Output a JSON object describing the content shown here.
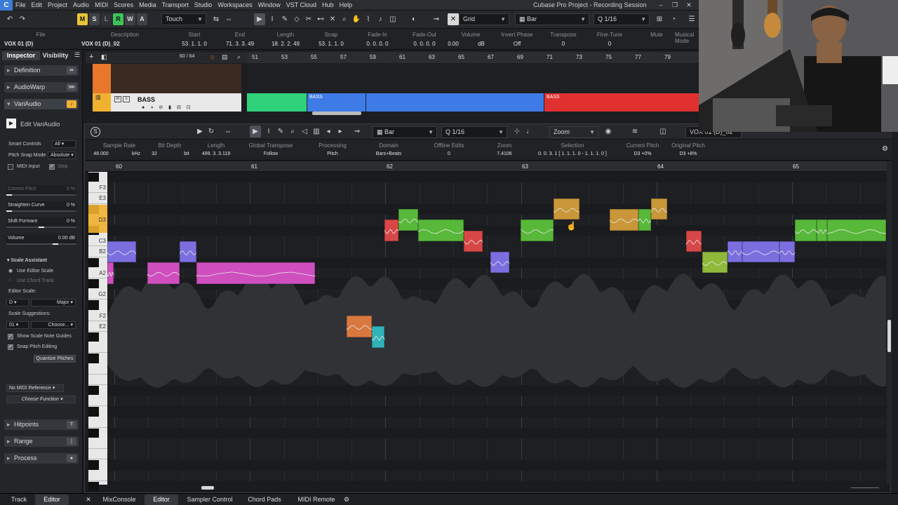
{
  "window": {
    "title": "Cubase Pro Project - Recording Session"
  },
  "menu": [
    "File",
    "Edit",
    "Project",
    "Audio",
    "MIDI",
    "Scores",
    "Media",
    "Transport",
    "Studio",
    "Workspaces",
    "Window",
    "VST Cloud",
    "Hub",
    "Help"
  ],
  "toolbar": {
    "modes": [
      "M",
      "S",
      "L",
      "R",
      "W",
      "A"
    ],
    "automation_mode": "Touch",
    "snap_type": "Grid",
    "grid_type": "Bar",
    "quantize": "1/16"
  },
  "infoline": {
    "headers": [
      "File",
      "Description",
      "Start",
      "End",
      "Length",
      "Snap",
      "Fade-In",
      "Fade-Out",
      "Volume",
      "Invert Phase",
      "Transpose",
      "Fine-Tune",
      "Mute",
      "Musical Mode"
    ],
    "values": [
      "VOX 01 (D)",
      "VOX 01 (D)_02",
      "53. 1. 1. 0",
      "71. 3. 3. 49",
      "18. 2. 2. 49",
      "53. 1. 1. 0",
      "0. 0. 0. 0",
      "0. 0. 0. 0",
      "0.00",
      "dB",
      "Off",
      "0",
      "0",
      ""
    ]
  },
  "inspector": {
    "tabs": [
      "Inspector",
      "Visibility"
    ],
    "sections": {
      "definition": "Definition",
      "audiowarp": "AudioWarp",
      "variaudio": "VariAudio",
      "hitpoints": "Hitpoints",
      "range": "Range",
      "process": "Process"
    },
    "edit_variaudio": "Edit VariAudio",
    "smart_controls_label": "Smart Controls",
    "smart_controls_value": "All",
    "pitch_snap_label": "Pitch Snap Mode",
    "pitch_snap_value": "Absolute",
    "midi_input": "MIDI Input",
    "step": "Step",
    "sliders": [
      {
        "label": "Correct Pitch",
        "value": "0 %",
        "level": 0
      },
      {
        "label": "Straighten Curve",
        "value": "0 %",
        "level": 0
      },
      {
        "label": "Shift Formant",
        "value": "0 %",
        "level": 0.5
      },
      {
        "label": "Volume",
        "value": "0.00 dB",
        "level": 0.72
      }
    ],
    "scale_assistant": "Scale Assistant",
    "use_editor_scale": "Use Editor Scale",
    "use_chord_track": "Use Chord Track",
    "editor_scale_label": "Editor Scale:",
    "scale_root": "D",
    "scale_type": "Major",
    "scale_suggestions_label": "Scale Suggestions:",
    "scale_suggestion_index": "01",
    "scale_suggestion_choose": "Choose...",
    "show_scale_guides": "Show Scale Note Guides",
    "snap_pitch_editing": "Snap Pitch Editing",
    "quantize_pitches": "Quantize Pitches",
    "midi_reference": "No MIDI Reference",
    "choose_function": "Choose Function"
  },
  "project": {
    "counter": "60 / 64",
    "track_name": "BASS",
    "ruler_bars": [
      "51",
      "53",
      "55",
      "57",
      "59",
      "61",
      "63",
      "65",
      "67",
      "69",
      "71",
      "73",
      "75",
      "77",
      "79"
    ],
    "event_labels": [
      "BASS",
      "BASS"
    ]
  },
  "editor": {
    "grid_type": "Bar",
    "quantize": "1/16",
    "zoom_label": "Zoom",
    "track_selector": "VOX 01 (D)_02",
    "info_headers": [
      "Sample Rate",
      "Bit Depth",
      "Length",
      "Global Transpose",
      "Processing",
      "Domain",
      "Offline Edits",
      "Zoom",
      "Selection",
      "Current Pitch",
      "Original Pitch"
    ],
    "info_values": [
      "48.000",
      "kHz",
      "32",
      "bit",
      "499. 3. 3.119",
      "Follow",
      "Pitch",
      "Bars+Beats",
      "0",
      "7.4106",
      "0. 0. 3. 1 [ 1. 1. 1. 0 - 1. 1. 1. 0 ]",
      "D3 +0%",
      "D3 +8%"
    ],
    "ruler_bars": [
      "60",
      "61",
      "62",
      "63",
      "64",
      "65"
    ],
    "key_labels": [
      "F3",
      "E3",
      "D3",
      "C3",
      "B2",
      "A2",
      "G2",
      "F2",
      "E2"
    ],
    "notes": [
      {
        "pitch": "B2",
        "start": 0.0,
        "end": 0.037,
        "color": "#7b6fe0"
      },
      {
        "pitch": "A2",
        "start": 0.0,
        "end": 0.008,
        "color": "#cf4fbf"
      },
      {
        "pitch": "A2",
        "start": 0.051,
        "end": 0.093,
        "color": "#cf4fbf"
      },
      {
        "pitch": "B2",
        "start": 0.093,
        "end": 0.114,
        "color": "#7b6fe0"
      },
      {
        "pitch": "A2",
        "start": 0.114,
        "end": 0.267,
        "color": "#cf4fbf"
      },
      {
        "pitch": "E2",
        "start": 0.307,
        "end": 0.34,
        "color": "#d8783f"
      },
      {
        "pitch": "D#2",
        "start": 0.34,
        "end": 0.356,
        "color": "#2fb3b9"
      },
      {
        "pitch": "C#3",
        "start": 0.356,
        "end": 0.374,
        "color": "#d84747"
      },
      {
        "pitch": "D3",
        "start": 0.374,
        "end": 0.399,
        "color": "#58b83a"
      },
      {
        "pitch": "C#3",
        "start": 0.399,
        "end": 0.458,
        "color": "#58b83a"
      },
      {
        "pitch": "C3",
        "start": 0.458,
        "end": 0.482,
        "color": "#d84747"
      },
      {
        "pitch": "A#2",
        "start": 0.492,
        "end": 0.516,
        "color": "#7b6fe0"
      },
      {
        "pitch": "C#3",
        "start": 0.531,
        "end": 0.573,
        "color": "#58b83a"
      },
      {
        "pitch": "D#3",
        "start": 0.573,
        "end": 0.606,
        "color": "#c9973a"
      },
      {
        "pitch": "D3",
        "start": 0.645,
        "end": 0.682,
        "color": "#c9973a"
      },
      {
        "pitch": "D3",
        "start": 0.682,
        "end": 0.698,
        "color": "#58b83a"
      },
      {
        "pitch": "D#3",
        "start": 0.698,
        "end": 0.719,
        "color": "#c9973a"
      },
      {
        "pitch": "C3",
        "start": 0.743,
        "end": 0.763,
        "color": "#d84747"
      },
      {
        "pitch": "A#2",
        "start": 0.764,
        "end": 0.796,
        "color": "#8fb93a"
      },
      {
        "pitch": "B2",
        "start": 0.796,
        "end": 0.815,
        "color": "#7b6fe0"
      },
      {
        "pitch": "B2",
        "start": 0.815,
        "end": 0.863,
        "color": "#7b6fe0"
      },
      {
        "pitch": "B2",
        "start": 0.863,
        "end": 0.883,
        "color": "#7b6fe0"
      },
      {
        "pitch": "C#3",
        "start": 0.883,
        "end": 0.911,
        "color": "#58b83a"
      },
      {
        "pitch": "C#3",
        "start": 0.911,
        "end": 0.924,
        "color": "#58b83a"
      },
      {
        "pitch": "C#3",
        "start": 0.924,
        "end": 1.0,
        "color": "#58b83a"
      }
    ]
  },
  "bottom_tabs": [
    "Track",
    "Editor",
    "MixConsole",
    "Editor",
    "Sampler Control",
    "Chord Pads",
    "MIDI Remote"
  ],
  "colors": {
    "accent": "#3b7dd8",
    "variaudio_active": "#f0b030",
    "bass_green": "#2fd27a",
    "bass_blue": "#3f7be6",
    "bass_red": "#e03030"
  }
}
